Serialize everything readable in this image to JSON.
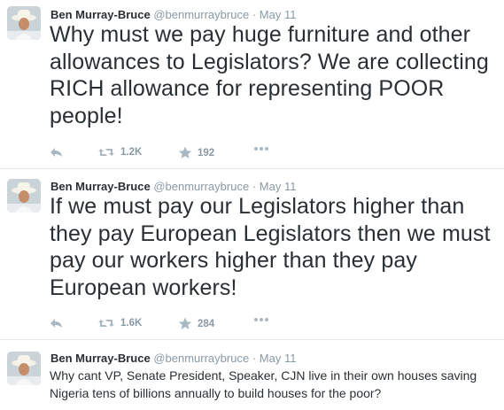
{
  "tweets": [
    {
      "name": "Ben Murray-Bruce",
      "handle": "@benmurraybruce",
      "separator": "·",
      "time": "May 11",
      "text": "Why must we pay huge furniture and other allowances to Legislators? We are collecting RICH allowance for representing POOR people!",
      "retweets": "1.2K",
      "favorites": "192"
    },
    {
      "name": "Ben Murray-Bruce",
      "handle": "@benmurraybruce",
      "separator": "·",
      "time": "May 11",
      "text": "If we must pay our Legislators higher than they pay European Legislators then we must pay our workers higher than they pay European workers!",
      "retweets": "1.6K",
      "favorites": "284"
    },
    {
      "name": "Ben Murray-Bruce",
      "handle": "@benmurraybruce",
      "separator": "·",
      "time": "May 11",
      "text": "Why cant VP, Senate President, Speaker, CJN live in their own houses saving Nigeria tens of billions annually to build houses for the poor?"
    }
  ],
  "icons": {
    "reply": "reply-icon",
    "retweet": "retweet-icon",
    "favorite": "star-icon",
    "more": "more-icon"
  },
  "colors": {
    "text": "#292f33",
    "meta": "#8899a6",
    "action_icon": "#aab8c2",
    "divider": "#e1e8ed"
  }
}
